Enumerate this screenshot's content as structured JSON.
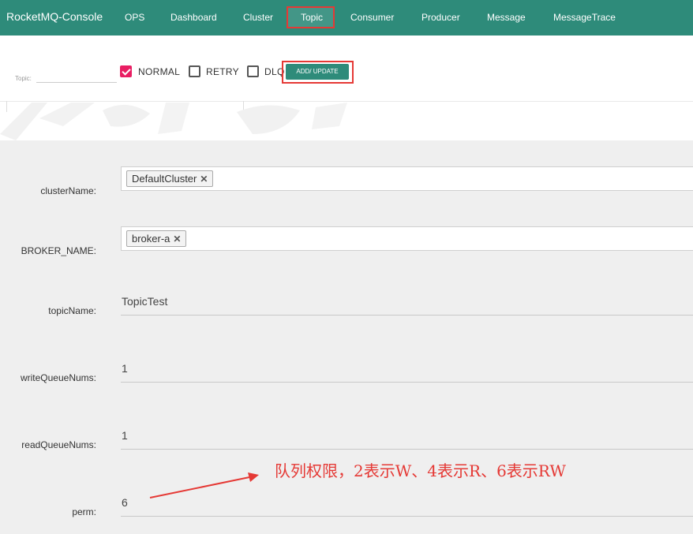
{
  "nav": {
    "brand": "RocketMQ-Console",
    "items": [
      "OPS",
      "Dashboard",
      "Cluster",
      "Topic",
      "Consumer",
      "Producer",
      "Message",
      "MessageTrace"
    ],
    "active": "Topic"
  },
  "toolbar": {
    "topic_label": "Topic:",
    "topic_value": "",
    "checkboxes": [
      {
        "label": "NORMAL",
        "checked": true
      },
      {
        "label": "RETRY",
        "checked": false
      },
      {
        "label": "DLQ",
        "checked": false
      }
    ],
    "add_button": "ADD/ UPDATE"
  },
  "form": {
    "clusterName": {
      "label": "clusterName:",
      "tag": "DefaultCluster"
    },
    "brokerName": {
      "label": "BROKER_NAME:",
      "tag": "broker-a"
    },
    "topicName": {
      "label": "topicName:",
      "value": "TopicTest"
    },
    "writeQueueNums": {
      "label": "writeQueueNums:",
      "value": "1"
    },
    "readQueueNums": {
      "label": "readQueueNums:",
      "value": "1"
    },
    "perm": {
      "label": "perm:",
      "value": "6"
    }
  },
  "annotation": "队列权限，2表示W、4表示R、6表示RW",
  "colors": {
    "nav": "#2e8b7a",
    "highlight": "#e53935",
    "checkbox": "#e91e63",
    "panel": "#efefef"
  }
}
